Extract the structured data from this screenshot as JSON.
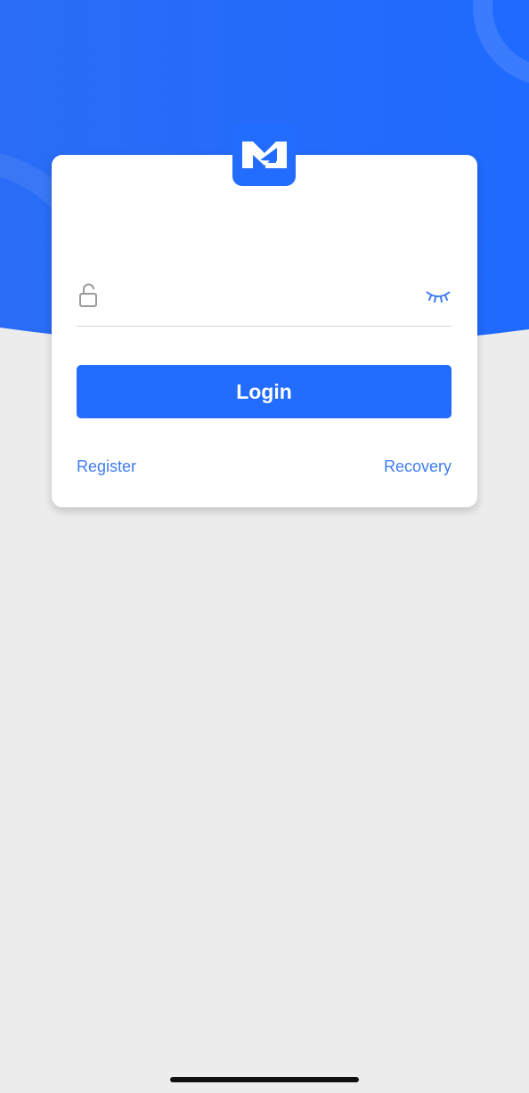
{
  "colors": {
    "brand": "#226cff",
    "link": "#3e7cf0",
    "background": "#ececec",
    "card": "#ffffff"
  },
  "logo": {
    "icon": "mail-m-logo-icon"
  },
  "password": {
    "value": "",
    "placeholder": "",
    "lock_icon": "lock-open-icon",
    "visibility_icon": "eye-closed-icon"
  },
  "login": {
    "label": "Login"
  },
  "links": {
    "register": "Register",
    "recovery": "Recovery"
  }
}
